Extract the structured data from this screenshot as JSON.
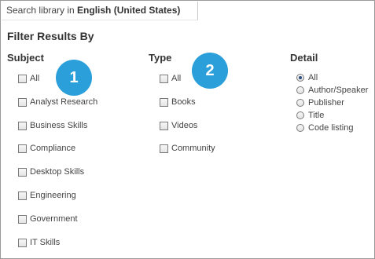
{
  "search": {
    "prefix": "Search library in ",
    "language": "English (United States)"
  },
  "filter_heading": "Filter Results By",
  "subject": {
    "title": "Subject",
    "items": [
      "All",
      "Analyst Research",
      "Business Skills",
      "Compliance",
      "Desktop Skills",
      "Engineering",
      "Government",
      "IT Skills"
    ]
  },
  "type": {
    "title": "Type",
    "items": [
      "All",
      "Books",
      "Videos",
      "Community"
    ]
  },
  "detail": {
    "title": "Detail",
    "items": [
      "All",
      "Author/Speaker",
      "Publisher",
      "Title",
      "Code listing"
    ],
    "selected": "All"
  },
  "callouts": [
    "1",
    "2"
  ],
  "colors": {
    "callout": "#2b9fd9",
    "text": "#333333"
  }
}
